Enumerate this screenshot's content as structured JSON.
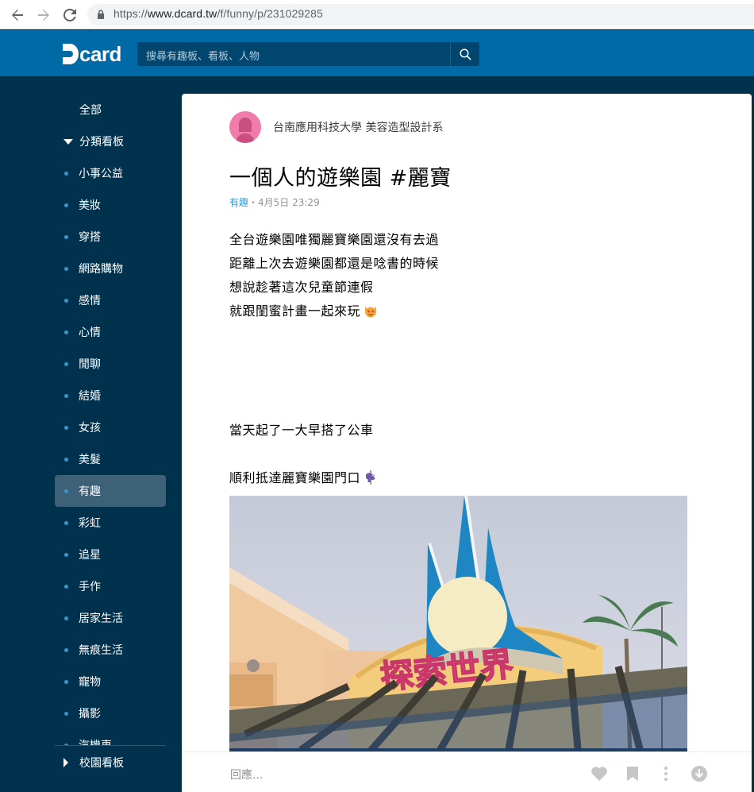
{
  "browser": {
    "url_scheme": "https://",
    "url_host": "www.dcard.tw",
    "url_path": "/f/funny/p/231029285"
  },
  "header": {
    "logo_text": "card",
    "search_placeholder": "搜尋有趣板、看板、人物",
    "brand_color": "#006aa6"
  },
  "sidebar": {
    "all_label": "全部",
    "category_label": "分類看板",
    "items": [
      {
        "label": "小事公益"
      },
      {
        "label": "美妝"
      },
      {
        "label": "穿搭"
      },
      {
        "label": "網路購物"
      },
      {
        "label": "感情"
      },
      {
        "label": "心情"
      },
      {
        "label": "閒聊"
      },
      {
        "label": "結婚"
      },
      {
        "label": "女孩"
      },
      {
        "label": "美髮"
      },
      {
        "label": "有趣",
        "active": true
      },
      {
        "label": "彩虹"
      },
      {
        "label": "追星"
      },
      {
        "label": "手作"
      },
      {
        "label": "居家生活"
      },
      {
        "label": "無痕生活"
      },
      {
        "label": "寵物"
      },
      {
        "label": "攝影"
      },
      {
        "label": "汽機車"
      }
    ],
    "campus_label": "校園看板"
  },
  "post": {
    "author": "台南應用科技大學 美容造型設計系",
    "title": "一個人的遊樂園 #麗寶",
    "forum": "有趣",
    "separator": "・",
    "date": "4月5日 23:29",
    "lines": [
      "全台遊樂園唯獨麗寶樂園還沒有去過",
      "距離上次去遊樂園都還是唸書的時候",
      "想說趁著這次兒童節連假",
      "就跟閨蜜計畫一起來玩"
    ],
    "line5": "當天起了一大早搭了公車",
    "line6": "順利抵達麗寶樂園門口",
    "photo_sign": "探索世界"
  },
  "replybar": {
    "placeholder": "回應..."
  }
}
